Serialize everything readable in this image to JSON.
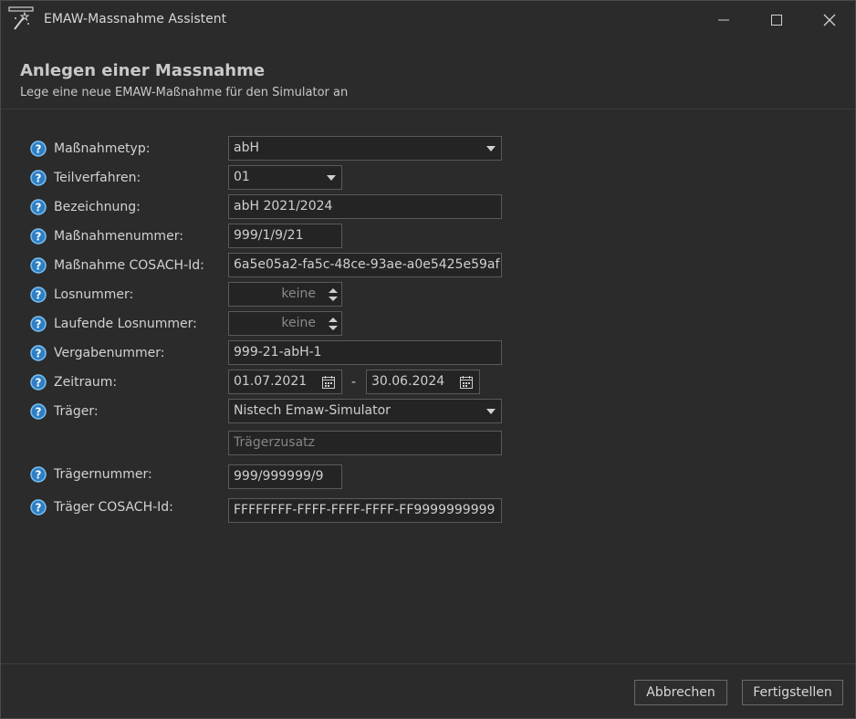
{
  "window": {
    "title": "EMAW-Massnahme Assistent"
  },
  "header": {
    "title": "Anlegen einer Massnahme",
    "subtitle": "Lege eine neue EMAW-Maßnahme für den Simulator an"
  },
  "form": {
    "massnahmetyp": {
      "label": "Maßnahmetyp:",
      "value": "abH"
    },
    "teilverfahren": {
      "label": "Teilverfahren:",
      "value": "01"
    },
    "bezeichnung": {
      "label": "Bezeichnung:",
      "value": "abH 2021/2024"
    },
    "massnahmennummer": {
      "label": "Maßnahmenummer:",
      "value": "999/1/9/21"
    },
    "cosach_id": {
      "label": "Maßnahme COSACH-Id:",
      "value": "6a5e05a2-fa5c-48ce-93ae-a0e5425e59af"
    },
    "losnummer": {
      "label": "Losnummer:",
      "value": "keine"
    },
    "laufende_losnummer": {
      "label": "Laufende Losnummer:",
      "value": "keine"
    },
    "vergabenummer": {
      "label": "Vergabenummer:",
      "value": "999-21-abH-1"
    },
    "zeitraum": {
      "label": "Zeitraum:",
      "from": "01.07.2021",
      "separator": "-",
      "to": "30.06.2024"
    },
    "traeger": {
      "label": "Träger:",
      "value": "Nistech Emaw-Simulator"
    },
    "traegerzusatz": {
      "placeholder": "Trägerzusatz"
    },
    "traegernummer": {
      "label": "Trägernummer:",
      "value": "999/999999/9"
    },
    "traeger_cosach_id": {
      "label": "Träger COSACH-Id:",
      "value": "FFFFFFFF-FFFF-FFFF-FFFF-FF9999999999"
    }
  },
  "buttons": {
    "cancel": "Abbrechen",
    "finish": "Fertigstellen"
  },
  "colors": {
    "background": "#2b2b2b",
    "help_icon": "#4aa3e8",
    "field_border": "#5a5a5a"
  }
}
